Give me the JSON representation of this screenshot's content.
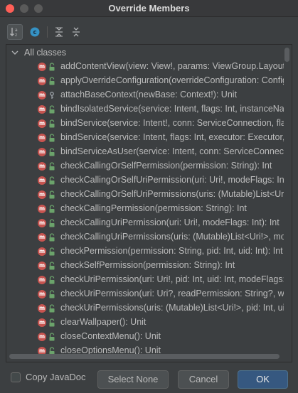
{
  "window": {
    "title": "Override Members"
  },
  "toolbar": {
    "sort_icon": "sort-alphabetically-icon",
    "class_icon": "show-classes-icon",
    "expand_icon": "expand-all-icon",
    "collapse_icon": "collapse-all-icon"
  },
  "tree": {
    "group_label": "All classes",
    "items": [
      {
        "text": "addContentView(view: View!, params: ViewGroup.LayoutParams!): Unit",
        "vis": "public"
      },
      {
        "text": "applyOverrideConfiguration(overrideConfiguration: Configuration!): Unit",
        "vis": "public"
      },
      {
        "text": "attachBaseContext(newBase: Context!): Unit",
        "vis": "protected"
      },
      {
        "text": "bindIsolatedService(service: Intent, flags: Int, instanceName: String, executor: Executor, conn: ServiceConnection): Boolean",
        "vis": "public"
      },
      {
        "text": "bindService(service: Intent!, conn: ServiceConnection, flags: Int): Boolean",
        "vis": "public"
      },
      {
        "text": "bindService(service: Intent, flags: Int, executor: Executor, conn: ServiceConnection): Boolean",
        "vis": "public"
      },
      {
        "text": "bindServiceAsUser(service: Intent, conn: ServiceConnection, flags: Int, user: UserHandle): Boolean",
        "vis": "public"
      },
      {
        "text": "checkCallingOrSelfPermission(permission: String): Int",
        "vis": "public"
      },
      {
        "text": "checkCallingOrSelfUriPermission(uri: Uri!, modeFlags: Int): Int",
        "vis": "public"
      },
      {
        "text": "checkCallingOrSelfUriPermissions(uris: (Mutable)List<Uri!>, modeFlags: Int): IntArray",
        "vis": "public"
      },
      {
        "text": "checkCallingPermission(permission: String): Int",
        "vis": "public"
      },
      {
        "text": "checkCallingUriPermission(uri: Uri!, modeFlags: Int): Int",
        "vis": "public"
      },
      {
        "text": "checkCallingUriPermissions(uris: (Mutable)List<Uri!>, modeFlags: Int): IntArray",
        "vis": "public"
      },
      {
        "text": "checkPermission(permission: String, pid: Int, uid: Int): Int",
        "vis": "public"
      },
      {
        "text": "checkSelfPermission(permission: String): Int",
        "vis": "public"
      },
      {
        "text": "checkUriPermission(uri: Uri!, pid: Int, uid: Int, modeFlags: Int): Int",
        "vis": "public"
      },
      {
        "text": "checkUriPermission(uri: Uri?, readPermission: String?, writePermission: String?, pid: Int, uid: Int, modeFlags: Int): Int",
        "vis": "public"
      },
      {
        "text": "checkUriPermissions(uris: (Mutable)List<Uri!>, pid: Int, uid: Int, modeFlags: Int): IntArray",
        "vis": "public"
      },
      {
        "text": "clearWallpaper(): Unit",
        "vis": "public"
      },
      {
        "text": "closeContextMenu(): Unit",
        "vis": "public"
      },
      {
        "text": "closeOptionsMenu(): Unit",
        "vis": "public"
      }
    ]
  },
  "footer": {
    "copy_javadoc_label": "Copy JavaDoc",
    "copy_javadoc_checked": false,
    "select_none_label": "Select None",
    "cancel_label": "Cancel",
    "ok_label": "OK"
  },
  "colors": {
    "method_icon": "#c75450",
    "public_lock": "#6ba36b",
    "protected_key": "#9aa0a6",
    "ok_button": "#365880"
  }
}
